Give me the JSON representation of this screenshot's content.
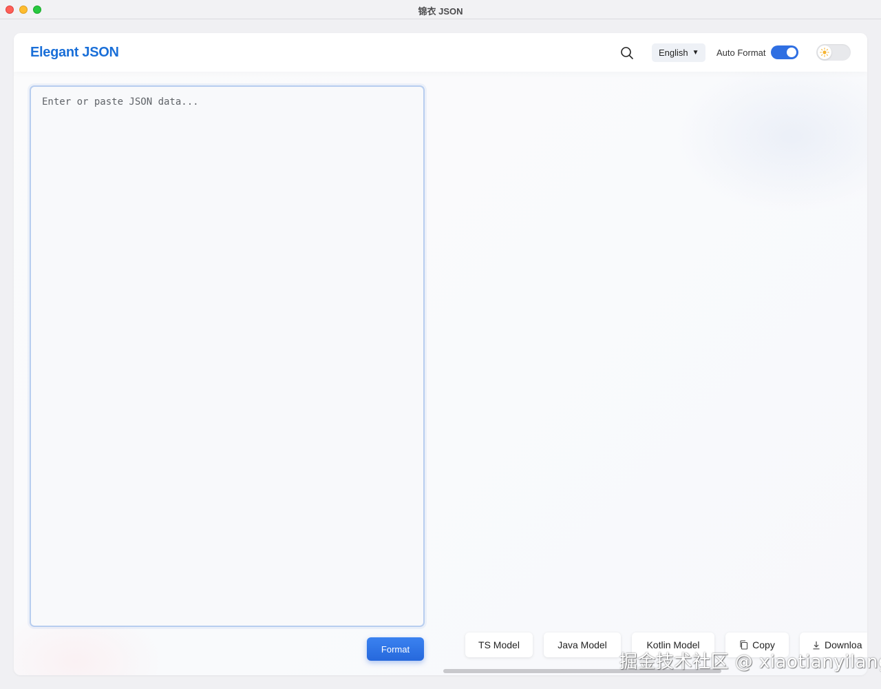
{
  "window": {
    "title": "锦衣 JSON"
  },
  "header": {
    "brand": "Elegant JSON",
    "language": "English",
    "auto_format_label": "Auto Format",
    "auto_format_on": true
  },
  "editor": {
    "placeholder": "Enter or paste JSON data..."
  },
  "format_button": "Format",
  "actions": {
    "ts_model": "TS Model",
    "java_model": "Java Model",
    "kotlin_model": "Kotlin Model",
    "copy": "Copy",
    "download": "Downloa"
  },
  "watermark": "掘金技术社区 @ xiaotianyilang",
  "colors": {
    "brand": "#1a6fd8",
    "accent": "#2f6fe2"
  }
}
